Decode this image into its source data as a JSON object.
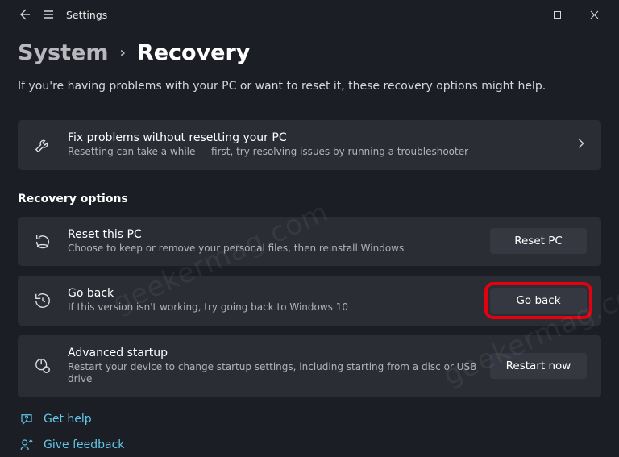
{
  "titlebar": {
    "app": "Settings"
  },
  "breadcrumb": {
    "parent": "System",
    "current": "Recovery"
  },
  "intro": "If you're having problems with your PC or want to reset it, these recovery options might help.",
  "fix": {
    "title": "Fix problems without resetting your PC",
    "sub": "Resetting can take a while — first, try resolving issues by running a troubleshooter"
  },
  "section_label": "Recovery options",
  "reset": {
    "title": "Reset this PC",
    "sub": "Choose to keep or remove your personal files, then reinstall Windows",
    "button": "Reset PC"
  },
  "goback": {
    "title": "Go back",
    "sub": "If this version isn't working, try going back to Windows 10",
    "button": "Go back"
  },
  "advanced": {
    "title": "Advanced startup",
    "sub": "Restart your device to change startup settings, including starting from a disc or USB drive",
    "button": "Restart now"
  },
  "help": "Get help",
  "feedback": "Give feedback",
  "watermark": "geekermag.com"
}
